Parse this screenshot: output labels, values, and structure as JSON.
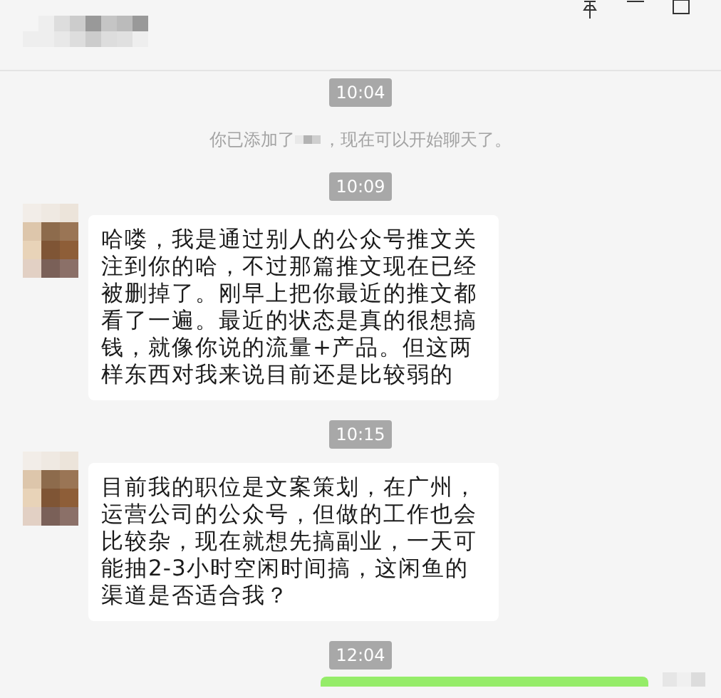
{
  "window": {
    "controls": [
      {
        "kind": "pin"
      },
      {
        "kind": "minimize"
      },
      {
        "kind": "maximize"
      }
    ]
  },
  "messages": [
    {
      "kind": "time",
      "text": "10:04"
    },
    {
      "kind": "system",
      "before": "你已添加了",
      "after": "，现在可以开始聊天了。"
    },
    {
      "kind": "time",
      "text": "10:09"
    },
    {
      "kind": "incoming",
      "text": "哈喽，我是通过别人的公众号推文关注到你的哈，不过那篇推文现在已经被删掉了。刚早上把你最近的推文都看了一遍。最近的状态是真的很想搞钱，就像你说的流量+产品。但这两样东西对我来说目前还是比较弱的"
    },
    {
      "kind": "time",
      "text": "10:15"
    },
    {
      "kind": "incoming",
      "text": "目前我的职位是文案策划，在广州，运营公司的公众号，但做的工作也会比较杂，现在就想先搞副业，一天可能抽2-3小时空闲时间搞，这闲鱼的渠道是否适合我？"
    },
    {
      "kind": "time",
      "text": "12:04"
    },
    {
      "kind": "outgoing"
    }
  ]
}
